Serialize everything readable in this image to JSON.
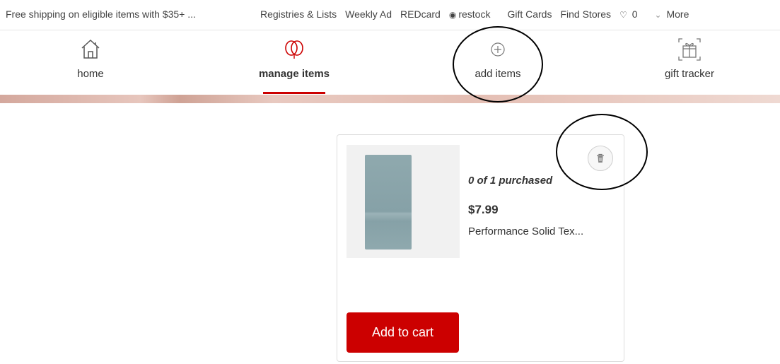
{
  "topbar": {
    "promo": "Free shipping on eligible items with $35+ ...",
    "links": [
      {
        "label": "Registries & Lists"
      },
      {
        "label": "Weekly Ad"
      },
      {
        "label": "REDcard"
      },
      {
        "label": "restock"
      },
      {
        "label": "Gift Cards"
      },
      {
        "label": "Find Stores"
      }
    ],
    "wishlist_count": "0",
    "more_label": "More"
  },
  "tabs": [
    {
      "label": "home",
      "icon": "home-icon"
    },
    {
      "label": "manage items",
      "icon": "balloon-icon",
      "active": true
    },
    {
      "label": "add items",
      "icon": "plus-circle-icon"
    },
    {
      "label": "gift tracker",
      "icon": "gift-icon"
    }
  ],
  "item": {
    "purchased": "0 of 1 purchased",
    "price": "$7.99",
    "title": "Performance Solid Tex...",
    "add_to_cart": "Add to cart"
  },
  "colors": {
    "accent": "#cc0000"
  }
}
